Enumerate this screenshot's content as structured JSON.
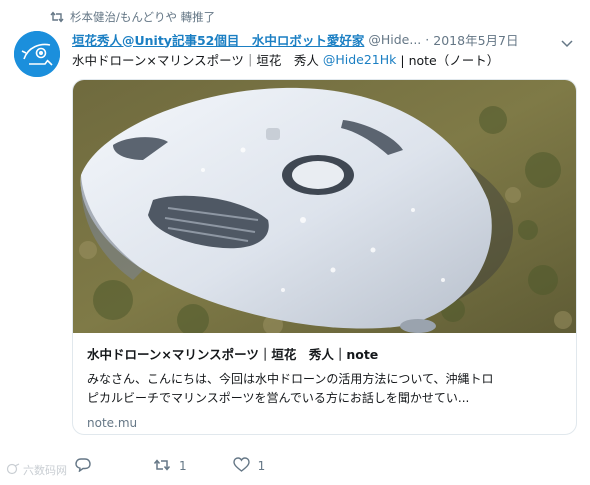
{
  "retweet": {
    "icon": "retweet-icon",
    "text": "杉本健治/もんどりや 轉推了"
  },
  "author": {
    "name": "垣花秀人@Unity記事52個目　水中ロボット愛好家",
    "handle": "@Hide...",
    "separator": "·",
    "date": "2018年5月7日",
    "avatar_color": "#1b8fdc"
  },
  "tweet": {
    "text": "水中ドローン×マリンスポーツ｜垣花　秀人",
    "mention": "@Hide21Hk",
    "tail": "| note（ノート）"
  },
  "card": {
    "title": "水中ドローン×マリンスポーツ｜垣花　秀人｜note",
    "description_line1": "みなさん、こんにちは、今回は水中ドローンの活用方法について、沖縄トロ",
    "description_line2": "ピカルビーチでマリンスポーツを営んでいる方にお話しを聞かせてい...",
    "domain": "note.mu"
  },
  "actions": {
    "reply_icon": "reply-icon",
    "retweet_icon": "retweet-icon",
    "retweet_count": "1",
    "like_icon": "heart-icon",
    "like_count": "1"
  },
  "watermark": "六数码网",
  "colors": {
    "link": "#1b7fc3",
    "muted": "#657786",
    "border": "#e1e8ed"
  }
}
